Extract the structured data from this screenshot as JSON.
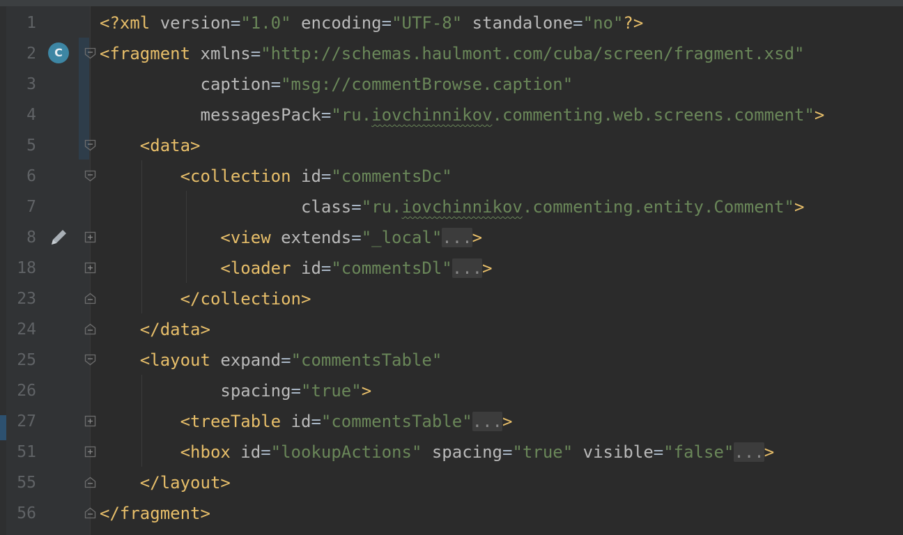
{
  "gutter": {
    "line_numbers": [
      "1",
      "2",
      "3",
      "4",
      "5",
      "6",
      "7",
      "8",
      "18",
      "23",
      "24",
      "25",
      "26",
      "27",
      "51",
      "55",
      "56"
    ],
    "implementation_badge": "C"
  },
  "code": {
    "l1": {
      "open": "<?xml",
      "a1": "version",
      "v1": "\"1.0\"",
      "a2": "encoding",
      "v2": "\"UTF-8\"",
      "a3": "standalone",
      "v3": "\"no\"",
      "close": "?>"
    },
    "l2": {
      "tag": "<fragment",
      "attr": "xmlns",
      "val": "\"http://schemas.haulmont.com/cuba/screen/fragment.xsd\""
    },
    "l3": {
      "attr": "caption",
      "val": "\"msg://commentBrowse.caption\""
    },
    "l4": {
      "attr": "messagesPack",
      "val_pre": "\"ru.",
      "val_typo": "iovchinnikov",
      "val_post": ".commenting.web.screens.comment\"",
      "close": ">"
    },
    "l5": {
      "tag": "<data>"
    },
    "l6": {
      "tag": "<collection",
      "attr": "id",
      "val": "\"commentsDc\""
    },
    "l7": {
      "attr": "class",
      "val_pre": "\"ru.",
      "val_typo": "iovchinnikov",
      "val_post": ".commenting.entity.Comment\"",
      "close": ">"
    },
    "l8": {
      "tag": "<view",
      "attr": "extends",
      "val": "\"_local\"",
      "fold": "...",
      "close": ">"
    },
    "l18": {
      "tag": "<loader",
      "attr": "id",
      "val": "\"commentsDl\"",
      "fold": "...",
      "close": ">"
    },
    "l23": {
      "tag": "</collection>"
    },
    "l24": {
      "tag": "</data>"
    },
    "l25": {
      "tag": "<layout",
      "attr": "expand",
      "val": "\"commentsTable\""
    },
    "l26": {
      "attr": "spacing",
      "val": "\"true\"",
      "close": ">"
    },
    "l27": {
      "tag": "<treeTable",
      "attr": "id",
      "val": "\"commentsTable\"",
      "fold": "...",
      "close": ">"
    },
    "l51": {
      "tag": "<hbox",
      "a1": "id",
      "v1": "\"lookupActions\"",
      "a2": "spacing",
      "v2": "\"true\"",
      "a3": "visible",
      "v3": "\"false\"",
      "fold": "...",
      "close": ">"
    },
    "l55": {
      "tag": "</layout>"
    },
    "l56": {
      "tag": "</fragment>"
    }
  },
  "colors": {
    "background": "#2b2b2b",
    "tag": "#e8bf6a",
    "attribute": "#bababa",
    "value": "#6a8759",
    "line_number": "#606366"
  }
}
